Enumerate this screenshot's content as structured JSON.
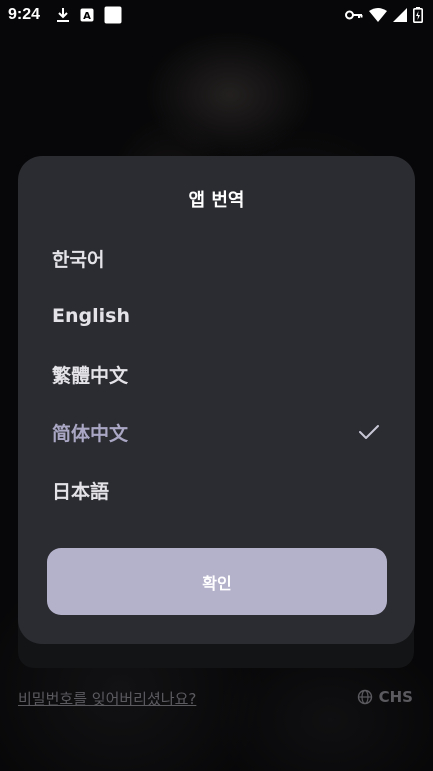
{
  "status_bar": {
    "time": "9:24",
    "icons": [
      "download-icon",
      "translate-icon",
      "square-icon",
      "vpn-key-icon",
      "wifi-icon",
      "signal-icon",
      "battery-icon"
    ]
  },
  "background": {
    "forgot_password": "비밀번호를 잊어버리셨나요?",
    "language_code": "CHS"
  },
  "dialog": {
    "title": "앱 번역",
    "options": [
      {
        "label": "한국어",
        "selected": false
      },
      {
        "label": "English",
        "selected": false
      },
      {
        "label": "繁體中文",
        "selected": false
      },
      {
        "label": "简体中文",
        "selected": true
      },
      {
        "label": "日本語",
        "selected": false
      }
    ],
    "confirm_label": "확인"
  },
  "colors": {
    "dialog_bg": "#2b2c31",
    "selected_text": "#a9a7c4",
    "confirm_button": "#b4b1cb"
  }
}
